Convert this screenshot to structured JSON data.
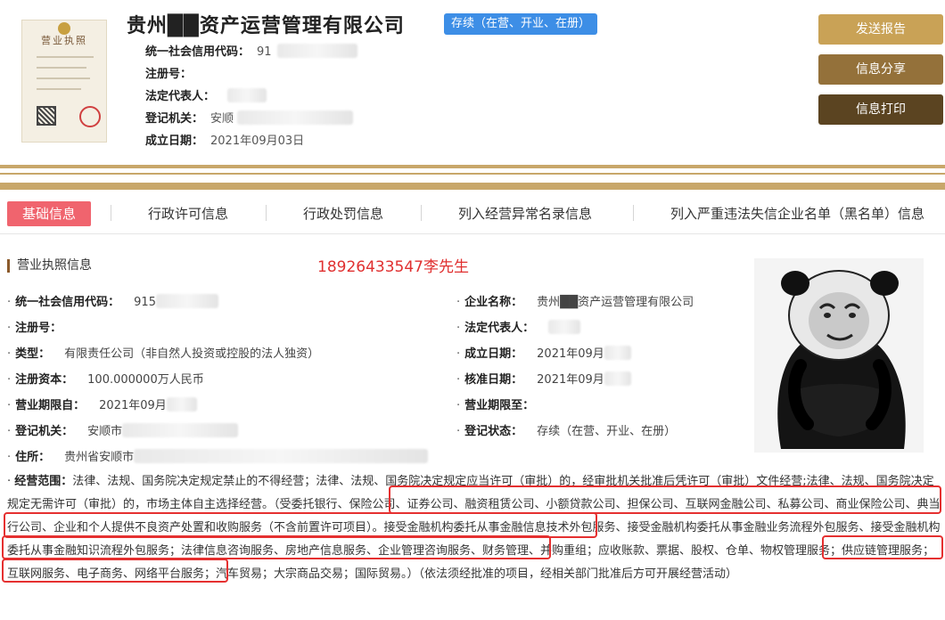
{
  "header": {
    "company_name": "贵州██资产运营管理有限公司",
    "status_tag": "存续（在营、开业、在册）",
    "license_thumb_title": "营业执照",
    "fields": [
      {
        "label": "统一社会信用代码：",
        "value": "91"
      },
      {
        "label": "注册号：",
        "value": ""
      },
      {
        "label": "法定代表人：",
        "value": ""
      },
      {
        "label": "登记机关：",
        "value": "安顺"
      },
      {
        "label": "成立日期：",
        "value": "2021年09月03日"
      }
    ],
    "buttons": [
      "发送报告",
      "信息分享",
      "信息打印"
    ]
  },
  "tabs": [
    "基础信息",
    "行政许可信息",
    "行政处罚信息",
    "列入经营异常名录信息",
    "列入严重违法失信企业名单（黑名单）信息"
  ],
  "section": {
    "title": "营业执照信息",
    "phone_note": "18926433547李先生"
  },
  "fields_left": [
    {
      "label": "统一社会信用代码：",
      "value": "915"
    },
    {
      "label": "注册号：",
      "value": ""
    },
    {
      "label": "类型：",
      "value": "有限责任公司（非自然人投资或控股的法人独资）"
    },
    {
      "label": "注册资本：",
      "value": "100.000000万人民币"
    },
    {
      "label": "营业期限自：",
      "value": "2021年09月"
    },
    {
      "label": "登记机关：",
      "value": "安顺市"
    },
    {
      "label": "住所：",
      "value": "贵州省安顺市"
    }
  ],
  "fields_right": [
    {
      "label": "企业名称：",
      "value": "贵州██资产运营管理有限公司"
    },
    {
      "label": "法定代表人：",
      "value": ""
    },
    {
      "label": "成立日期：",
      "value": "2021年09月"
    },
    {
      "label": "核准日期：",
      "value": "2021年09月"
    },
    {
      "label": "营业期限至：",
      "value": ""
    },
    {
      "label": "登记状态：",
      "value": "存续（在营、开业、在册）"
    }
  ],
  "scope": {
    "label": "经营范围：",
    "text": "法律、法规、国务院决定规定禁止的不得经营；法律、法规、国务院决定规定应当许可（审批）的，经审批机关批准后凭许可（审批）文件经营;法律、法规、国务院决定规定无需许可（审批）的，市场主体自主选择经营。（受委托银行、保险公司、证券公司、融资租赁公司、小额贷款公司、担保公司、互联网金融公司、私募公司、商业保险公司、典当行公司、企业和个人提供不良资产处置和收购服务（不含前置许可项目）。接受金融机构委托从事金融信息技术外包服务、接受金融机构委托从事金融业务流程外包服务、接受金融机构委托从事金融知识流程外包服务；法律信息咨询服务、房地产信息服务、企业管理咨询服务、财务管理、并购重组；应收账款、票据、股权、仓单、物权管理服务；供应链管理服务；互联网服务、电子商务、网络平台服务；汽车贸易；大宗商品交易；国际贸易。）（依法须经批准的项目，经相关部门批准后方可开展经营活动）"
  }
}
